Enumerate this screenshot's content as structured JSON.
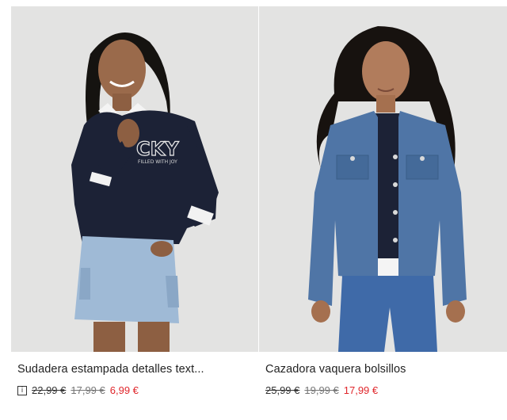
{
  "products": [
    {
      "title": "Sudadera estampada detalles text...",
      "info_icon": "i",
      "price_original": "22,99 €",
      "price_previous": "17,99 €",
      "price_current": "6,99 €",
      "sweater_print": "CKY",
      "sweater_subprint": "FILLED WITH JOY"
    },
    {
      "title": "Cazadora vaquera bolsillos",
      "price_original": "25,99 €",
      "price_previous": "19,99 €",
      "price_current": "17,99 €"
    }
  ],
  "colors": {
    "background": "#e3e3e2",
    "sale_price": "#e0262b",
    "sweater": "#1c2236",
    "denim_light": "#9fbad6",
    "denim_jacket": "#4f75a6"
  }
}
